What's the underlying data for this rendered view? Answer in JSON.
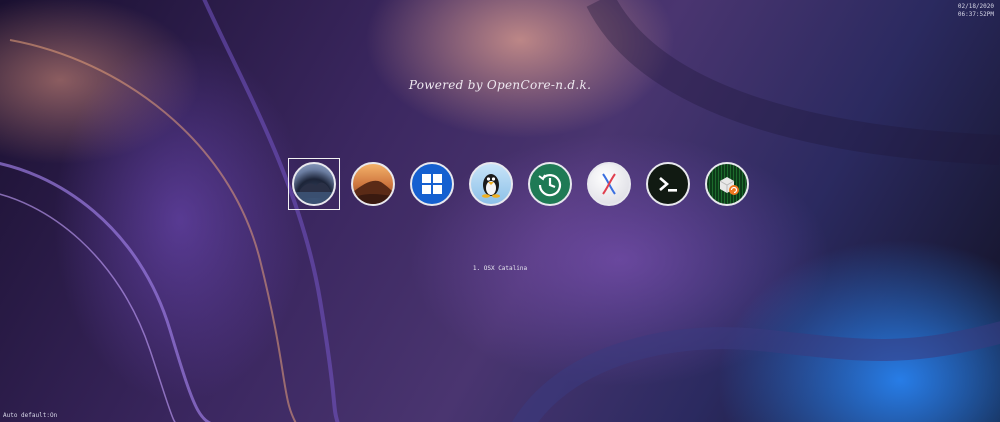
{
  "clock": {
    "date": "02/18/2020",
    "time": "06:37:52PM"
  },
  "title": "Powered by OpenCore-n.d.k.",
  "boot_entries": [
    {
      "icon": "catalina-icon",
      "selected": true
    },
    {
      "icon": "mojave-icon",
      "selected": false
    },
    {
      "icon": "windows-icon",
      "selected": false
    },
    {
      "icon": "linux-tux-icon",
      "selected": false
    },
    {
      "icon": "time-machine-icon",
      "selected": false
    },
    {
      "icon": "macos-x-icon",
      "selected": false
    },
    {
      "icon": "terminal-shell-icon",
      "selected": false
    },
    {
      "icon": "reset-nvram-icon",
      "selected": false
    }
  ],
  "selected_label": "1. OSX Catalina",
  "status": {
    "auto_default": "Auto default:On"
  }
}
